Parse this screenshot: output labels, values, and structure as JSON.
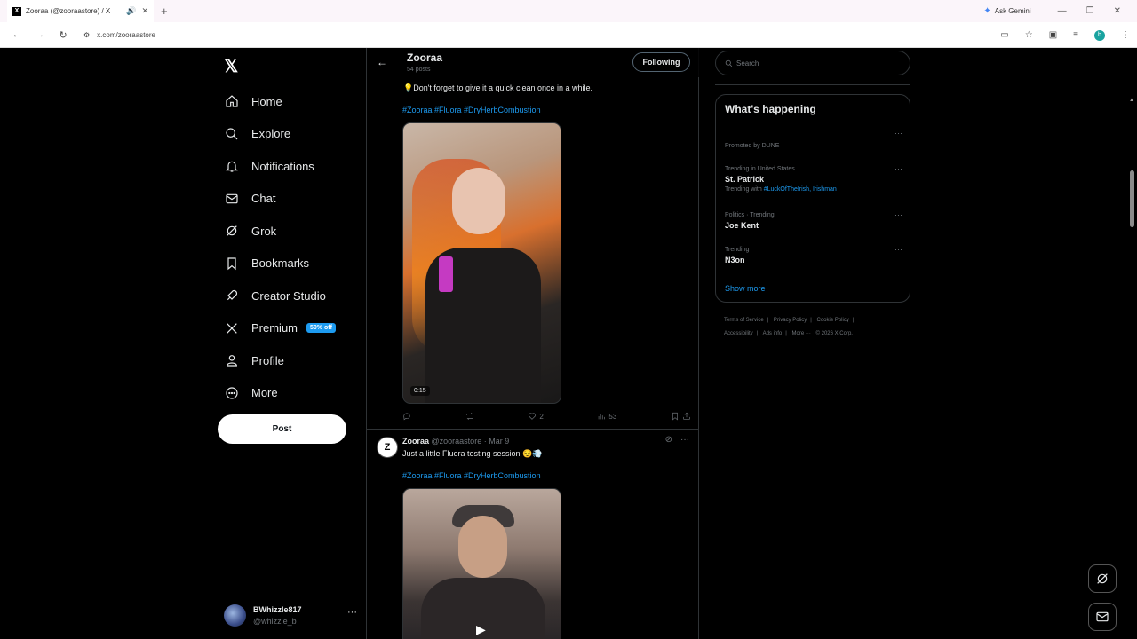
{
  "browser": {
    "tab_title": "Zooraa (@zooraastore) / X",
    "new_tab_symbol": "+",
    "ask_gemini": "Ask Gemini",
    "url": "x.com/zooraastore",
    "profile_initial": "b"
  },
  "nav": {
    "items": [
      {
        "label": "Home",
        "icon": "home-icon"
      },
      {
        "label": "Explore",
        "icon": "search-icon"
      },
      {
        "label": "Notifications",
        "icon": "bell-icon"
      },
      {
        "label": "Chat",
        "icon": "mail-icon"
      },
      {
        "label": "Grok",
        "icon": "grok-icon"
      },
      {
        "label": "Bookmarks",
        "icon": "bookmark-icon"
      },
      {
        "label": "Creator Studio",
        "icon": "rocket-icon"
      },
      {
        "label": "Premium",
        "icon": "x-logo-icon",
        "badge": "50% off"
      },
      {
        "label": "Profile",
        "icon": "person-icon"
      },
      {
        "label": "More",
        "icon": "more-circle-icon"
      }
    ],
    "post_button": "Post",
    "user": {
      "name": "BWhizzle817",
      "handle": "@whizzle_b"
    }
  },
  "profile_header": {
    "name": "Zooraa",
    "posts_count": "54 posts",
    "follow_button": "Following"
  },
  "tweet1": {
    "text": "💡Don't forget to give it a quick clean once in a while.",
    "hashtags": "#Zooraa #Fluora #DryHerbCombustion",
    "video_duration": "0:15",
    "likes": "2",
    "views": "53"
  },
  "tweet2": {
    "avatar_letter": "Z",
    "name": "Zooraa",
    "handle": "@zooraastore",
    "date": "· Mar 9",
    "text": "Just a little Fluora testing session 😌💨",
    "hashtags": "#Zooraa #Fluora #DryHerbCombustion"
  },
  "sidebar": {
    "search_placeholder": "Search",
    "whats_happening": "What's happening",
    "promoted": "Promoted by DUNE",
    "trends": [
      {
        "meta": "Trending in United States",
        "name": "St. Patrick",
        "with_prefix": "Trending with ",
        "with_link": "#LuckOfTheIrish, Irishman"
      },
      {
        "meta": "Politics · Trending",
        "name": "Joe Kent"
      },
      {
        "meta": "Trending",
        "name": "N3on"
      }
    ],
    "show_more": "Show more",
    "footer": [
      "Terms of Service",
      "|",
      "Privacy Policy",
      "|",
      "Cookie Policy",
      "|",
      "Accessibility",
      "|",
      "Ads info",
      "|",
      "More ···",
      "© 2026 X Corp."
    ]
  }
}
